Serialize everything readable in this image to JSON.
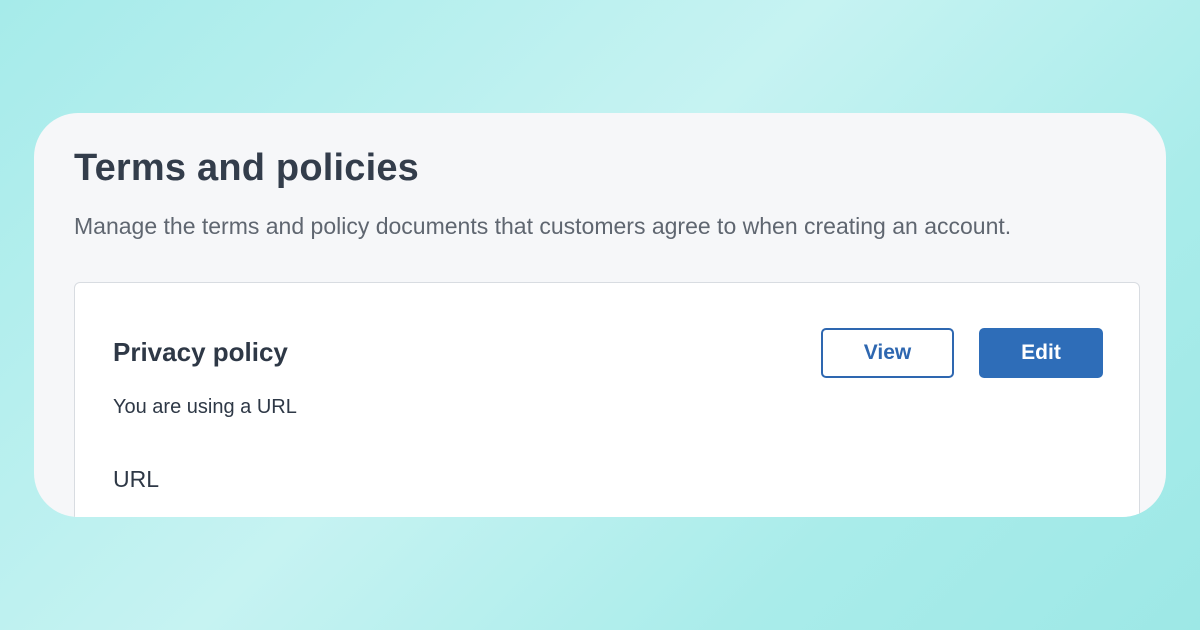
{
  "header": {
    "title": "Terms and policies",
    "subtitle": "Manage the terms and policy documents that customers agree to when creating an account."
  },
  "policy_card": {
    "title": "Privacy policy",
    "description": "You are using a URL",
    "field_label": "URL",
    "view_label": "View",
    "edit_label": "Edit"
  },
  "colors": {
    "background": "#a6ebea",
    "panel": "#f6f7f9",
    "card": "#ffffff",
    "text_dark": "#2e3846",
    "text_muted": "#5f6670",
    "accent_blue": "#2e6db8"
  }
}
